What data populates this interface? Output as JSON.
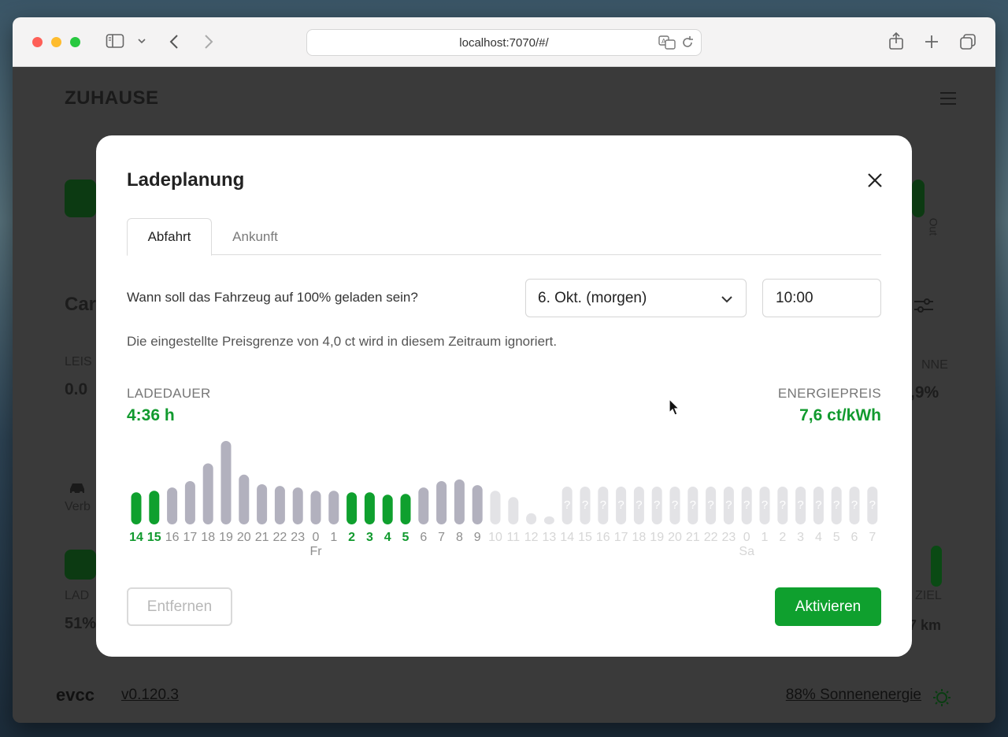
{
  "browser": {
    "url": "localhost:7070/#/"
  },
  "app": {
    "title": "ZUHAUSE",
    "fragments": {
      "car": "Car",
      "leistung": "LEIS",
      "power_value": "0.0",
      "sonne": "NNE",
      "sonne_value": ",9%",
      "verb": "Verb",
      "lad": "LAD",
      "soc_value": "51%",
      "ziel": "ZIEL",
      "km": "7 km",
      "out": "Out"
    },
    "footer": {
      "logo": "evcc",
      "version": "v0.120.3",
      "solar": "88% Sonnenenergie"
    }
  },
  "modal": {
    "title": "Ladeplanung",
    "tabs": [
      {
        "label": "Abfahrt",
        "active": true
      },
      {
        "label": "Ankunft",
        "active": false
      }
    ],
    "question": "Wann soll das Fahrzeug auf 100% geladen sein?",
    "date_select": {
      "value": "6. Okt. (morgen)"
    },
    "time_input": {
      "value": "10:00"
    },
    "note": "Die eingestellte Preisgrenze von 4,0 ct wird in diesem Zeitraum ignoriert.",
    "duration_label": "LADEDAUER",
    "duration_value": "4:36 h",
    "price_label": "ENERGIEPREIS",
    "price_value": "7,6 ct/kWh",
    "remove_label": "Entfernen",
    "activate_label": "Aktivieren"
  },
  "colors": {
    "accent_green": "#0fa02e",
    "bar_grey": "#b2b1be",
    "bar_light": "#e3e3e6",
    "text_green": "#119a2e"
  },
  "chart_data": {
    "type": "bar",
    "categories": [
      "14",
      "15",
      "16",
      "17",
      "18",
      "19",
      "20",
      "21",
      "22",
      "23",
      "0",
      "1",
      "2",
      "3",
      "4",
      "5",
      "6",
      "7",
      "8",
      "9",
      "10",
      "11",
      "12",
      "13",
      "14",
      "15",
      "16",
      "17",
      "18",
      "19",
      "20",
      "21",
      "22",
      "23",
      "0",
      "1",
      "2",
      "3",
      "4",
      "5",
      "6",
      "7"
    ],
    "day_markers": [
      {
        "index": 10,
        "label": "Fr"
      },
      {
        "index": 34,
        "label": "Sa"
      }
    ],
    "values": [
      4.0,
      4.2,
      4.6,
      5.4,
      7.6,
      10.4,
      6.2,
      5.0,
      4.8,
      4.6,
      4.2,
      4.2,
      4.0,
      4.0,
      3.7,
      3.8,
      4.6,
      5.4,
      5.6,
      4.9,
      4.2,
      3.4,
      1.4,
      1.0,
      null,
      null,
      null,
      null,
      null,
      null,
      null,
      null,
      null,
      null,
      null,
      null,
      null,
      null,
      null,
      null,
      null,
      null
    ],
    "states": [
      "charge",
      "charge",
      "grey",
      "grey",
      "grey",
      "grey",
      "grey",
      "grey",
      "grey",
      "grey",
      "grey",
      "grey",
      "charge",
      "charge",
      "charge",
      "charge",
      "grey",
      "grey",
      "grey",
      "grey",
      "light",
      "light",
      "light",
      "light",
      "unknown",
      "unknown",
      "unknown",
      "unknown",
      "unknown",
      "unknown",
      "unknown",
      "unknown",
      "unknown",
      "unknown",
      "unknown",
      "unknown",
      "unknown",
      "unknown",
      "unknown",
      "unknown",
      "unknown",
      "unknown"
    ],
    "unknown_marker": "?",
    "ylim": [
      0,
      10.4
    ],
    "xlabel": "",
    "ylabel": ""
  }
}
